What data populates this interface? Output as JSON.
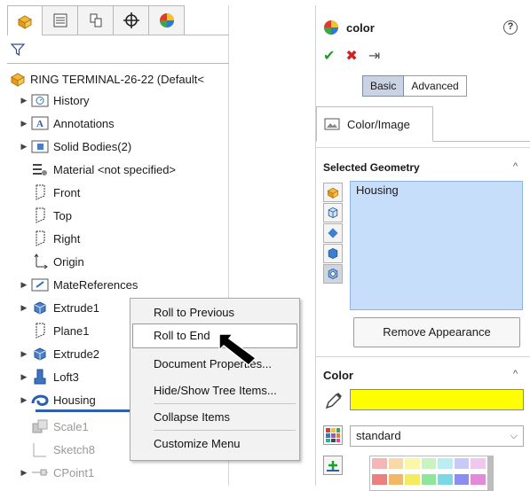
{
  "left_panel": {
    "root_label": "RING TERMINAL-26-22  (Default<",
    "items": [
      {
        "label": "History",
        "expandable": true,
        "grey": false
      },
      {
        "label": "Annotations",
        "expandable": true,
        "grey": false
      },
      {
        "label": "Solid Bodies(2)",
        "expandable": true,
        "grey": false
      },
      {
        "label": "Material <not specified>",
        "expandable": false,
        "grey": false
      },
      {
        "label": "Front",
        "expandable": false,
        "grey": false
      },
      {
        "label": "Top",
        "expandable": false,
        "grey": false
      },
      {
        "label": "Right",
        "expandable": false,
        "grey": false
      },
      {
        "label": "Origin",
        "expandable": false,
        "grey": false
      },
      {
        "label": "MateReferences",
        "expandable": true,
        "grey": false
      },
      {
        "label": "Extrude1",
        "expandable": true,
        "grey": false
      },
      {
        "label": "Plane1",
        "expandable": false,
        "grey": false
      },
      {
        "label": "Extrude2",
        "expandable": true,
        "grey": false
      },
      {
        "label": "Loft3",
        "expandable": true,
        "grey": false
      },
      {
        "label": "Housing",
        "expandable": true,
        "grey": false
      },
      {
        "label": "Scale1",
        "expandable": false,
        "grey": true
      },
      {
        "label": "Sketch8",
        "expandable": false,
        "grey": true
      },
      {
        "label": "CPoint1",
        "expandable": true,
        "grey": true
      }
    ]
  },
  "context_menu": {
    "items": [
      "Roll to Previous",
      "Roll to End",
      "Document Properties...",
      "Hide/Show Tree Items...",
      "Collapse Items",
      "Customize Menu"
    ],
    "highlighted_index": 1
  },
  "right_panel": {
    "title": "color",
    "help_glyph": "?",
    "accept_glyph": "✔",
    "cancel_glyph": "✖",
    "pin_glyph": "⇥",
    "mode_tabs": [
      "Basic",
      "Advanced"
    ],
    "active_mode": "Basic",
    "tab_label": "Color/Image",
    "selected_geometry_title": "Selected Geometry",
    "selected_geometry_items": [
      "Housing"
    ],
    "remove_button": "Remove Appearance",
    "color_section_title": "Color",
    "color_value": "#ffff00",
    "palette_select": "standard"
  },
  "colors": {
    "selection_blue": "#c6defa",
    "rollback_bar": "#2f5fa8",
    "accept_green": "#1aa128",
    "cancel_red": "#d21f1f"
  }
}
